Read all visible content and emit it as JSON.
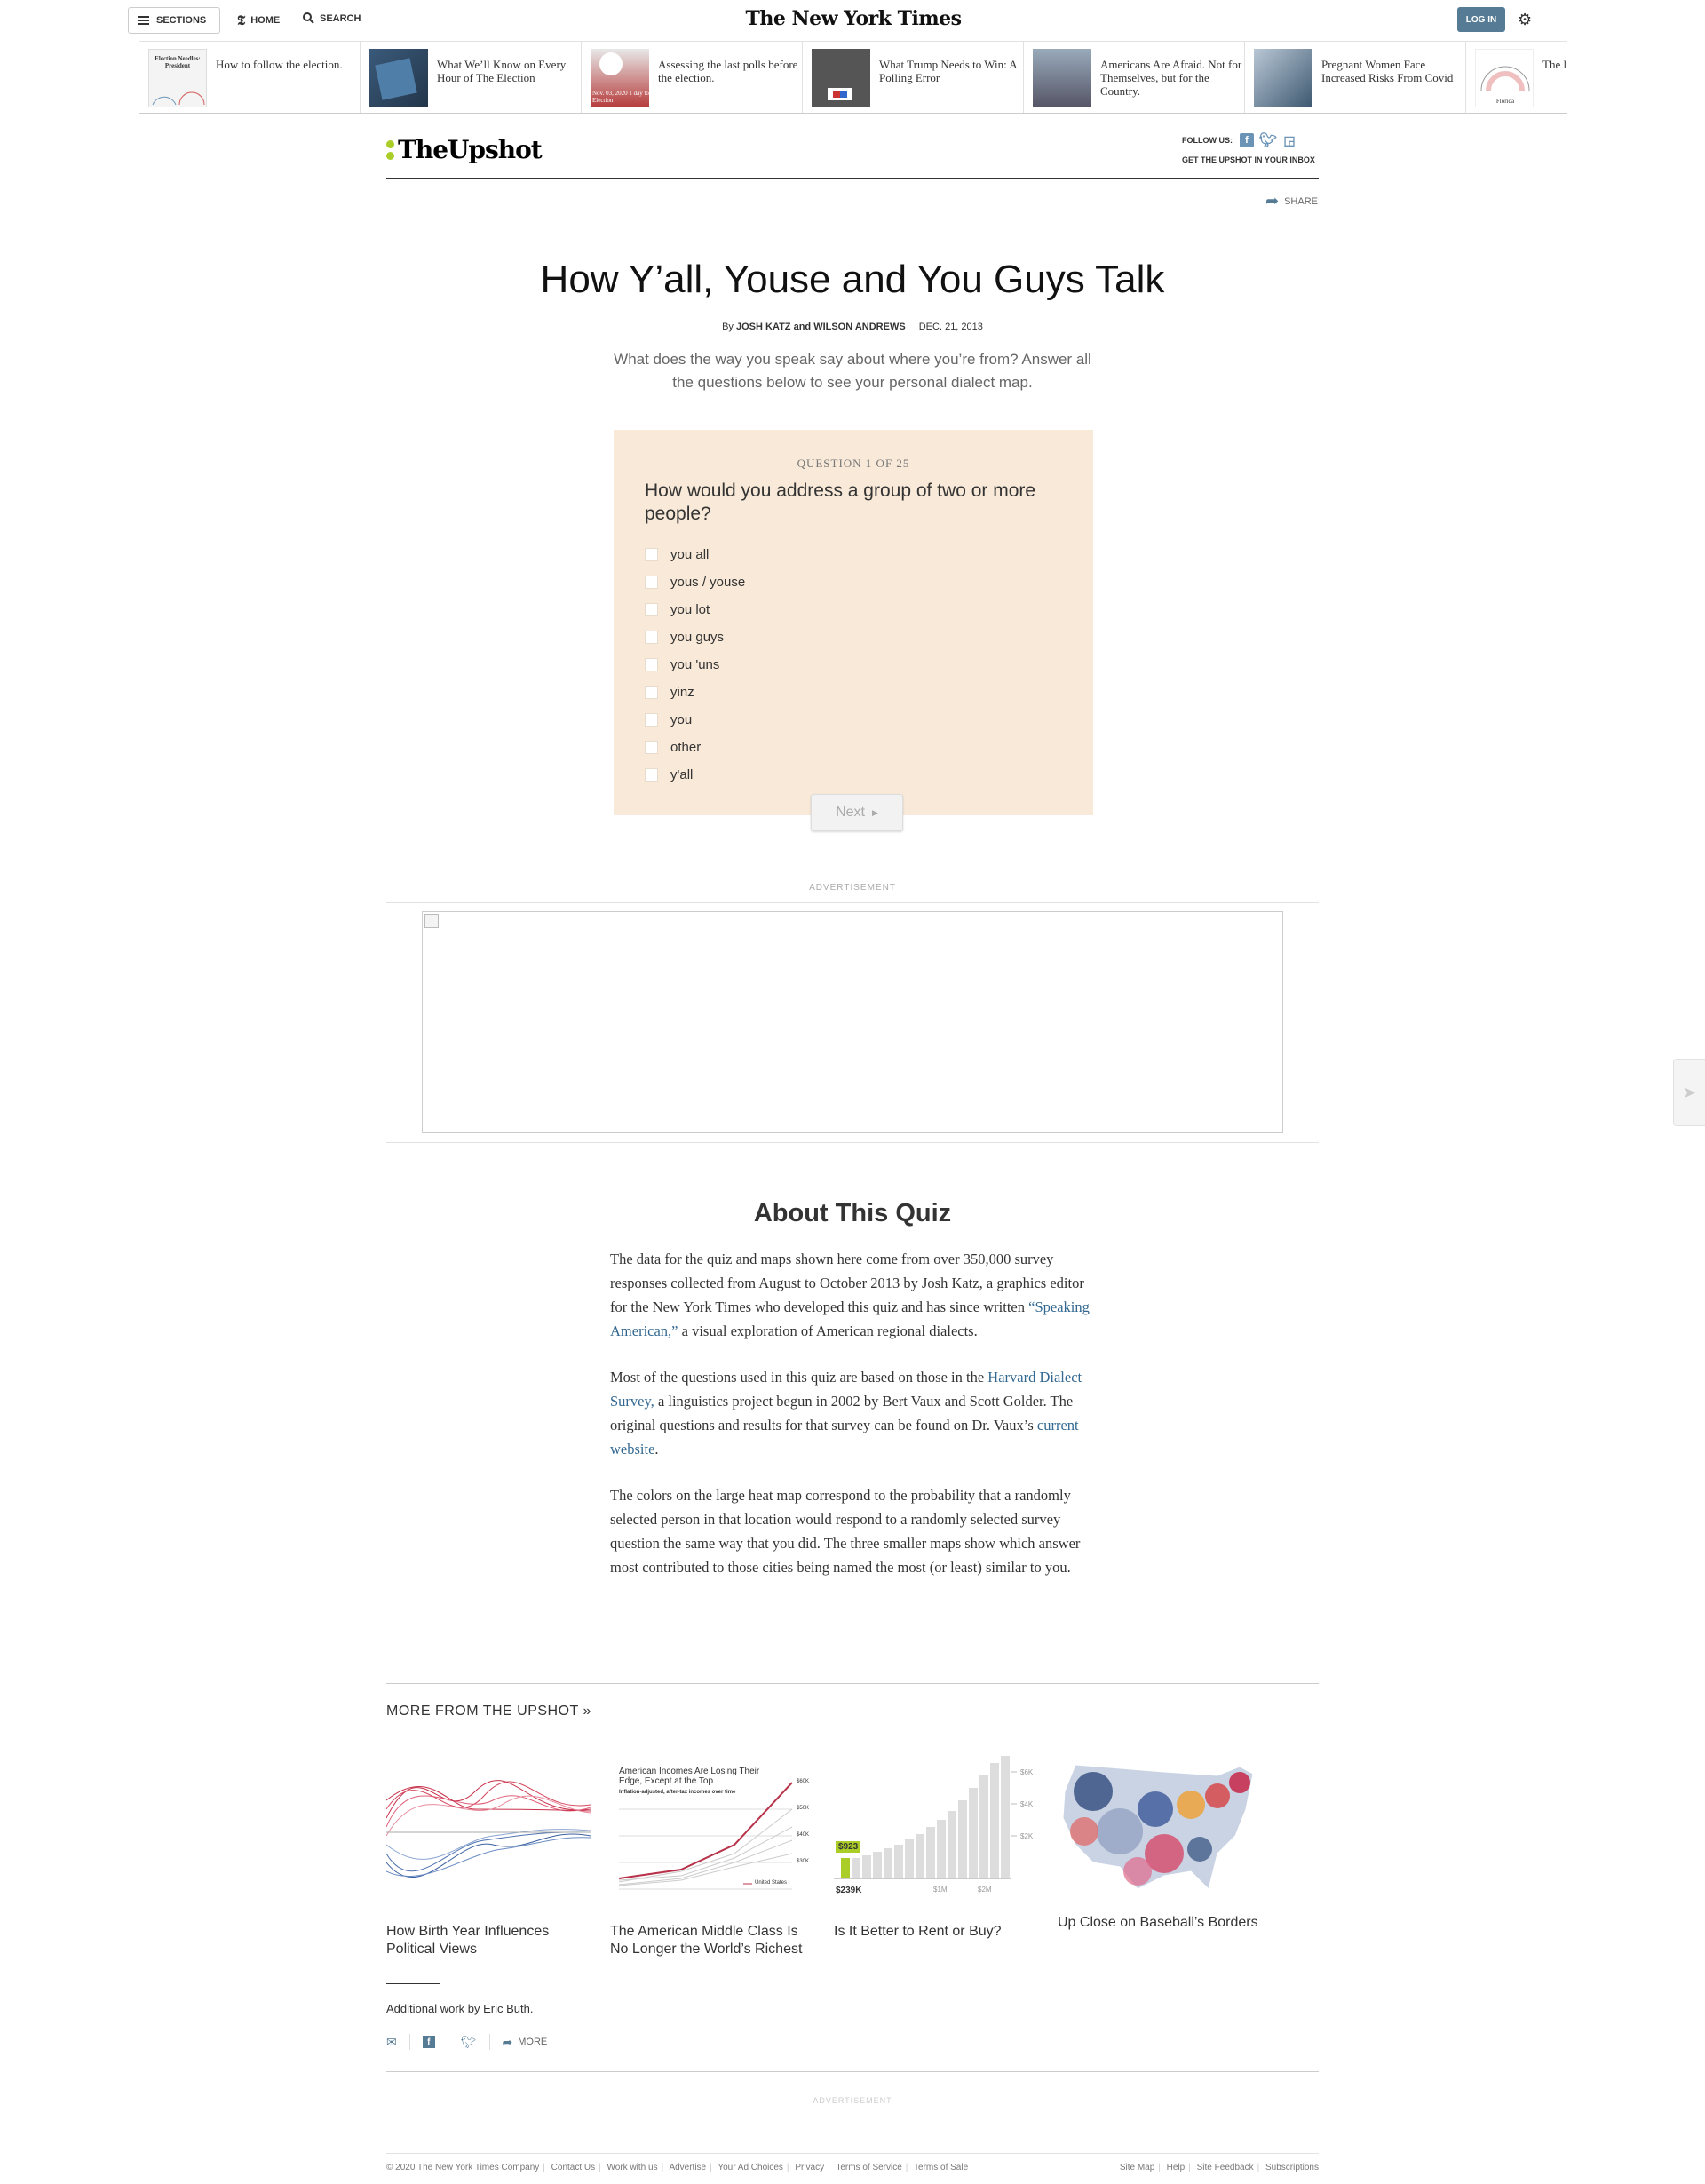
{
  "topnav": {
    "sections": "SECTIONS",
    "home": "HOME",
    "search": "SEARCH",
    "masthead": "The New York Times",
    "login": "LOG IN"
  },
  "ribbon": [
    {
      "title": "How to follow the election.",
      "thumb_text": "Election Needles: President"
    },
    {
      "title": "What We’ll Know on Every Hour of The Election",
      "thumb_text": ""
    },
    {
      "title": "Assessing the last polls before the election.",
      "thumb_text": "Nov. 03, 2020 1 day to Election"
    },
    {
      "title": "What Trump Needs to Win: A Polling Error",
      "thumb_text": ""
    },
    {
      "title": "Americans Are Afraid. Not for Themselves, but for the Country.",
      "thumb_text": ""
    },
    {
      "title": "Pregnant Women Face Increased Risks From Covid",
      "thumb_text": ""
    },
    {
      "title": "The l NC E to Ex",
      "thumb_text": "Florida"
    }
  ],
  "upshot": {
    "logo": "TheUpshot",
    "follow": "FOLLOW US:",
    "newsletter": "GET THE UPSHOT IN YOUR INBOX",
    "share": "SHARE"
  },
  "article": {
    "headline": "How Y’all, Youse and You Guys Talk",
    "by": "By",
    "authors": "JOSH KATZ and WILSON ANDREWS",
    "date": "DEC. 21, 2013",
    "dek": "What does the way you speak say about where you’re from? Answer all the questions below to see your personal dialect map."
  },
  "quiz": {
    "counter": "QUESTION 1 OF 25",
    "question": "How would you address a group of two or more people?",
    "options": [
      "you all",
      "yous / youse",
      "you lot",
      "you guys",
      "you 'uns",
      "yinz",
      "you",
      "other",
      "y'all"
    ],
    "next": "Next"
  },
  "ad": {
    "label": "ADVERTISEMENT"
  },
  "about": {
    "heading": "About This Quiz",
    "p1_a": "The data for the quiz and maps shown here come from over 350,000 survey responses collected from August to October 2013 by Josh Katz, a graphics editor for the New York Times who developed this quiz and has since written ",
    "p1_link": "“Speaking American,”",
    "p1_b": " a visual exploration of American regional dialects.",
    "p2_a": "Most of the questions used in this quiz are based on those in the ",
    "p2_link1": "Harvard Dialect Survey,",
    "p2_b": " a linguistics project begun in 2002 by Bert Vaux and Scott Golder. The original questions and results for that survey can be found on Dr. Vaux’s ",
    "p2_link2": "current website",
    "p2_c": ".",
    "p3": "The colors on the large heat map correspond to the probability that a randomly selected person in that location would respond to a randomly selected survey question the same way that you did. The three smaller maps show which answer most contributed to those cities being named the most (or least) similar to you."
  },
  "more": {
    "heading": "MORE FROM THE UPSHOT »",
    "cards": [
      {
        "title": "How Birth Year Influences Political Views"
      },
      {
        "title": "The American Middle Class Is No Longer the World’s Richest",
        "thumb_title": "American Incomes Are Losing Their Edge, Except at the Top",
        "thumb_sub": "Inflation-adjusted, after-tax incomes over time",
        "thumb_legend": "United States"
      },
      {
        "title": "Is It Better to Rent or Buy?",
        "thumb_badge": "$923",
        "thumb_low": "$239K",
        "thumb_mid": "$1M",
        "thumb_high": "$2M",
        "thumb_y1": "$6K",
        "thumb_y2": "$4K",
        "thumb_y3": "$2K"
      },
      {
        "title": "Up Close on Baseball’s Borders"
      }
    ]
  },
  "credits": {
    "additional": "Additional work by Eric Buth.",
    "more": "MORE"
  },
  "footer": {
    "left": [
      "© 2020 The New York Times Company",
      "Contact Us",
      "Work with us",
      "Advertise",
      "Your Ad Choices",
      "Privacy",
      "Terms of Service",
      "Terms of Sale"
    ],
    "right": [
      "Site Map",
      "Help",
      "Site Feedback",
      "Subscriptions"
    ]
  },
  "colors": {
    "accent": "#567b95",
    "quiz_bg": "#f8e9d8",
    "upshot_green": "#aacd28",
    "link": "#326891"
  }
}
